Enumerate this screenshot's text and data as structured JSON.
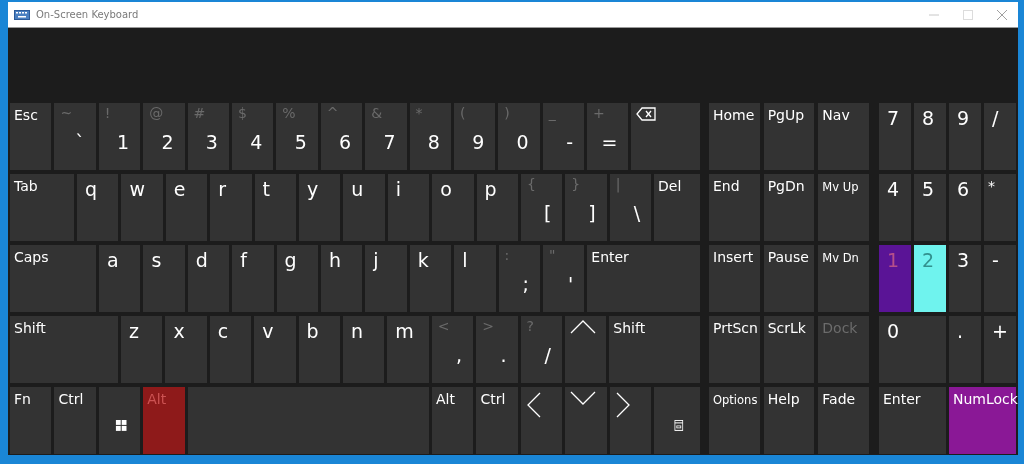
{
  "window": {
    "title": "On-Screen Keyboard"
  },
  "main_rows": [
    [
      {
        "kind": "word",
        "label": "Esc"
      },
      {
        "kind": "symbol",
        "top": "~",
        "label": "`"
      },
      {
        "kind": "symbol",
        "top": "!",
        "label": "1"
      },
      {
        "kind": "symbol",
        "top": "@",
        "label": "2"
      },
      {
        "kind": "symbol",
        "top": "#",
        "label": "3"
      },
      {
        "kind": "symbol",
        "top": "$",
        "label": "4"
      },
      {
        "kind": "symbol",
        "top": "%",
        "label": "5"
      },
      {
        "kind": "symbol",
        "top": "^",
        "label": "6"
      },
      {
        "kind": "symbol",
        "top": "&",
        "label": "7"
      },
      {
        "kind": "symbol",
        "top": "*",
        "label": "8"
      },
      {
        "kind": "symbol",
        "top": "(",
        "label": "9"
      },
      {
        "kind": "symbol",
        "top": ")",
        "label": "0"
      },
      {
        "kind": "symbol",
        "top": "_",
        "label": "-"
      },
      {
        "kind": "symbol",
        "top": "+",
        "label": "="
      },
      {
        "kind": "backspace"
      }
    ],
    [
      {
        "kind": "word",
        "label": "Tab"
      },
      {
        "kind": "letter",
        "label": "q"
      },
      {
        "kind": "letter",
        "label": "w"
      },
      {
        "kind": "letter",
        "label": "e"
      },
      {
        "kind": "letter",
        "label": "r"
      },
      {
        "kind": "letter",
        "label": "t"
      },
      {
        "kind": "letter",
        "label": "y"
      },
      {
        "kind": "letter",
        "label": "u"
      },
      {
        "kind": "letter",
        "label": "i"
      },
      {
        "kind": "letter",
        "label": "o"
      },
      {
        "kind": "letter",
        "label": "p"
      },
      {
        "kind": "symbol",
        "top": "{",
        "label": "["
      },
      {
        "kind": "symbol",
        "top": "}",
        "label": "]"
      },
      {
        "kind": "symbol",
        "top": "|",
        "label": "\\"
      },
      {
        "kind": "word",
        "label": "Del"
      }
    ],
    [
      {
        "kind": "word",
        "label": "Caps"
      },
      {
        "kind": "letter",
        "label": "a"
      },
      {
        "kind": "letter",
        "label": "s"
      },
      {
        "kind": "letter",
        "label": "d"
      },
      {
        "kind": "letter",
        "label": "f"
      },
      {
        "kind": "letter",
        "label": "g"
      },
      {
        "kind": "letter",
        "label": "h"
      },
      {
        "kind": "letter",
        "label": "j"
      },
      {
        "kind": "letter",
        "label": "k"
      },
      {
        "kind": "letter",
        "label": "l"
      },
      {
        "kind": "symbol",
        "top": ":",
        "label": ";"
      },
      {
        "kind": "symbol",
        "top": "\"",
        "label": "'"
      },
      {
        "kind": "word",
        "label": "Enter"
      }
    ],
    [
      {
        "kind": "word",
        "label": "Shift"
      },
      {
        "kind": "letter",
        "label": "z"
      },
      {
        "kind": "letter",
        "label": "x"
      },
      {
        "kind": "letter",
        "label": "c"
      },
      {
        "kind": "letter",
        "label": "v"
      },
      {
        "kind": "letter",
        "label": "b"
      },
      {
        "kind": "letter",
        "label": "n"
      },
      {
        "kind": "letter",
        "label": "m"
      },
      {
        "kind": "symbol",
        "top": "<",
        "label": ","
      },
      {
        "kind": "symbol",
        "top": ">",
        "label": "."
      },
      {
        "kind": "symbol",
        "top": "?",
        "label": "/"
      },
      {
        "kind": "up"
      },
      {
        "kind": "word",
        "label": "Shift"
      }
    ],
    [
      {
        "kind": "word",
        "label": "Fn"
      },
      {
        "kind": "word",
        "label": "Ctrl"
      },
      {
        "kind": "windows"
      },
      {
        "kind": "word",
        "label": "Alt",
        "color": "#8e1a1a"
      },
      {
        "kind": "space"
      },
      {
        "kind": "word",
        "label": "Alt"
      },
      {
        "kind": "word",
        "label": "Ctrl"
      },
      {
        "kind": "left"
      },
      {
        "kind": "down"
      },
      {
        "kind": "right"
      },
      {
        "kind": "menu"
      }
    ]
  ],
  "nav_rows": [
    [
      {
        "kind": "word",
        "label": "Home",
        "disabled": false
      },
      {
        "kind": "word",
        "label": "PgUp",
        "disabled": false
      },
      {
        "kind": "word",
        "label": "Nav",
        "disabled": false
      }
    ],
    [
      {
        "kind": "word",
        "label": "End",
        "disabled": false
      },
      {
        "kind": "word",
        "label": "PgDn",
        "disabled": false
      },
      {
        "kind": "small",
        "label": "Mv Up",
        "disabled": false
      }
    ],
    [
      {
        "kind": "word",
        "label": "Insert",
        "disabled": false
      },
      {
        "kind": "word",
        "label": "Pause",
        "disabled": false
      },
      {
        "kind": "small",
        "label": "Mv Dn",
        "disabled": false
      }
    ],
    [
      {
        "kind": "word",
        "label": "PrtScn",
        "disabled": false
      },
      {
        "kind": "word",
        "label": "ScrLk",
        "disabled": false
      },
      {
        "kind": "word",
        "label": "Dock",
        "disabled": true
      }
    ],
    [
      {
        "kind": "small",
        "label": "Options",
        "disabled": false
      },
      {
        "kind": "word",
        "label": "Help",
        "disabled": false
      },
      {
        "kind": "word",
        "label": "Fade",
        "disabled": false
      }
    ]
  ],
  "numpad_rows": [
    [
      {
        "kind": "letter",
        "label": "7",
        "on": false
      },
      {
        "kind": "letter",
        "label": "8",
        "on": false
      },
      {
        "kind": "letter",
        "label": "9",
        "on": false
      },
      {
        "kind": "letter",
        "label": "/",
        "on": false
      }
    ],
    [
      {
        "kind": "letter",
        "label": "4",
        "on": false
      },
      {
        "kind": "letter",
        "label": "5",
        "on": false
      },
      {
        "kind": "letter",
        "label": "6",
        "on": false
      },
      {
        "kind": "word",
        "label": "*",
        "on": false
      }
    ],
    [
      {
        "kind": "letter",
        "label": "1",
        "on": false,
        "color": "#5a1496"
      },
      {
        "kind": "letter",
        "label": "2",
        "on": false,
        "color": "#6ff3ee"
      },
      {
        "kind": "letter",
        "label": "3",
        "on": false
      },
      {
        "kind": "letter",
        "label": "-",
        "on": false
      }
    ],
    [
      {
        "kind": "letter",
        "label": "0",
        "on": false
      },
      {
        "kind": "letter",
        "label": ".",
        "on": false
      },
      {
        "kind": "letter",
        "label": "+",
        "on": false
      }
    ],
    [
      {
        "kind": "word",
        "label": "Enter",
        "on": false
      },
      {
        "kind": "word",
        "label": "NumLock",
        "on": true
      }
    ]
  ]
}
